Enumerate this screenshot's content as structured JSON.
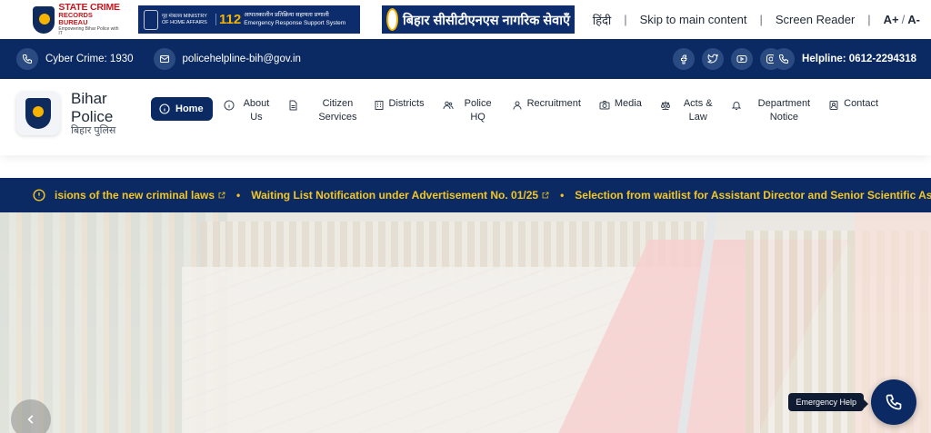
{
  "top": {
    "scrb": {
      "line1": "STATE CRIME",
      "line2": "RECORDS BUREAU",
      "tagline": "Empowering Bihar Police with IT"
    },
    "erss": {
      "ministry": "गृह मंत्रालय MINISTRY OF HOME AFFAIRS",
      "number": "112",
      "desc_hi": "आपातकालीन प्रतिक्रिया सहायता प्रणाली",
      "desc_en": "Emergency Response Support System"
    },
    "citizen_services": "बिहार सीसीटीएनएस नागरिक सेवाएँ",
    "links": {
      "hindi": "हिंदी",
      "skip": "Skip to main content",
      "screen_reader": "Screen Reader",
      "font_plus": "A+",
      "slash": "/",
      "font_minus": "A-"
    }
  },
  "info": {
    "cyber_crime": "Cyber Crime: 1930",
    "email": "policehelpline-bih@gov.in",
    "helpline": "Helpline: 0612-2294318",
    "social_icons": [
      "facebook-icon",
      "twitter-icon",
      "youtube-icon",
      "instagram-icon"
    ]
  },
  "brand": {
    "line1": "Bihar",
    "line2": "Police",
    "hindi": "बिहार पुलिस"
  },
  "nav": [
    {
      "id": "home",
      "label": "Home",
      "icon": "info-icon"
    },
    {
      "id": "about",
      "label": "About\nUs",
      "icon": "info-icon"
    },
    {
      "id": "citizen",
      "label": "Citizen\nServices",
      "icon": "document-icon"
    },
    {
      "id": "districts",
      "label": "Districts",
      "icon": "building-icon"
    },
    {
      "id": "hq",
      "label": "Police\nHQ",
      "icon": "people-icon"
    },
    {
      "id": "recruitment",
      "label": "Recruitment",
      "icon": "user-icon"
    },
    {
      "id": "media",
      "label": "Media",
      "icon": "camera-icon"
    },
    {
      "id": "acts",
      "label": "Acts &\nLaw",
      "icon": "scale-icon"
    },
    {
      "id": "notice",
      "label": "Department\nNotice",
      "icon": "bell-icon"
    },
    {
      "id": "contact",
      "label": "Contact",
      "icon": "contact-icon"
    }
  ],
  "ticker": [
    "isions of the new criminal laws",
    "Waiting List Notification under Advertisement No. 01/25",
    "Selection from waitlist for Assistant Director and Senior Scientific Assist"
  ],
  "ticker_sep": "•",
  "emergency": {
    "label": "Emergency Help"
  },
  "colors": {
    "navy": "#0b2a63",
    "ticker_text": "#f3c623",
    "scrb_red": "#c9161d"
  }
}
